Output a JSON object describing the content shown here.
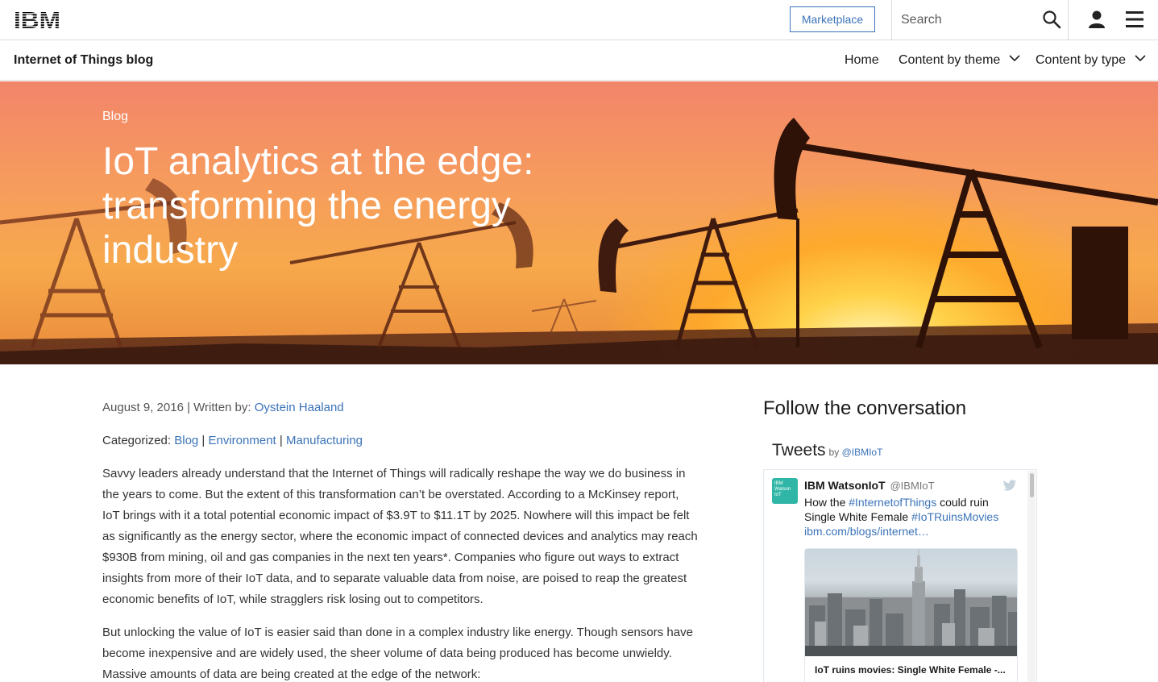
{
  "masthead": {
    "logo_text": "IBM",
    "marketplace_label": "Marketplace",
    "search_placeholder": "Search"
  },
  "subnav": {
    "blog_title": "Internet of Things blog",
    "items": [
      {
        "label": "Home"
      },
      {
        "label": "Content by theme"
      },
      {
        "label": "Content by type"
      }
    ]
  },
  "hero": {
    "kicker": "Blog",
    "title": "IoT analytics at the edge: transforming the energy industry"
  },
  "article": {
    "date": "August 9, 2016",
    "written_by_label": "| Written by:",
    "author": "Oystein Haaland",
    "categorized_label": "Categorized:",
    "categories": [
      "Blog",
      "Environment",
      "Manufacturing"
    ],
    "paragraph_1": "Savvy leaders already understand that the Internet of Things will radically reshape the way we do business in the years to come. But the extent of this transformation can’t be overstated. According to a McKinsey report, IoT brings with it a total potential economic impact of $3.9T to $11.1T by 2025. Nowhere will this impact be felt as significantly as the energy sector, where the economic impact of connected devices and analytics may reach $930B from mining, oil and gas companies in the next ten years*. Companies who figure out ways to extract insights from more of their IoT data, and to separate valuable data from noise, are poised to reap the greatest economic benefits of IoT, while stragglers risk losing out to competitors.",
    "paragraph_2": "But unlocking the value of IoT is easier said than done in a complex industry like energy. Though sensors have become inexpensive and are widely used, the sheer volume of data being produced has become unwieldy. Massive amounts of data are being created at the edge of the network:"
  },
  "sidebar": {
    "follow_title": "Follow the conversation",
    "tweets_title": "Tweets",
    "tweets_by": "by",
    "tweets_handle": "@IBMIoT",
    "tweet": {
      "avatar_text": "IBM Watson IoT",
      "author_name": "IBM WatsonIoT",
      "author_handle": "@IBMIoT",
      "text_prefix": "How the ",
      "hashtag_1": "#InternetofThings",
      "text_middle": " could ruin Single White Female ",
      "hashtag_2": "#IoTRuinsMovies",
      "link": "ibm.com/blogs/internet…",
      "card_title": "IoT ruins movies: Single White Female -..."
    }
  },
  "colors": {
    "link": "#3b73b9",
    "twitter_avatar": "#2fb6a6"
  },
  "icons": [
    "search-icon",
    "user-icon",
    "menu-icon",
    "chevron-down-icon",
    "twitter-bird-icon"
  ]
}
